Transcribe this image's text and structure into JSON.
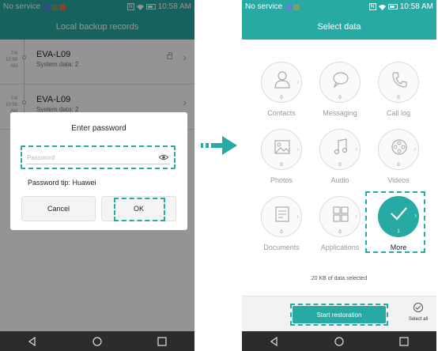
{
  "left": {
    "status": {
      "service": "No service",
      "time": "10:58 AM",
      "nfc": "N"
    },
    "title": "Local backup records",
    "records": [
      {
        "date_line1": "7/4",
        "date_line2": "10:58",
        "date_line3": "AM",
        "name": "EVA-L09",
        "sub": "System data: 2",
        "locked": true
      },
      {
        "date_line1": "7/4",
        "date_line2": "10:56",
        "date_line3": "AM",
        "name": "EVA-L09",
        "sub": "System data: 2",
        "locked": false
      }
    ],
    "dialog": {
      "title": "Enter password",
      "password_placeholder": "Password",
      "password_value": "",
      "tip": "Password tip: Huawei",
      "cancel_label": "Cancel",
      "ok_label": "OK"
    }
  },
  "right": {
    "status": {
      "service": "No service",
      "time": "10:58 AM",
      "nfc": "N"
    },
    "title": "Select data",
    "items": [
      {
        "label": "Contacts",
        "count": "0",
        "icon": "contacts-icon",
        "selected": false
      },
      {
        "label": "Messaging",
        "count": "0",
        "icon": "messaging-icon",
        "selected": false
      },
      {
        "label": "Call log",
        "count": "0",
        "icon": "call-log-icon",
        "selected": false
      },
      {
        "label": "Photos",
        "count": "0",
        "icon": "photos-icon",
        "selected": false
      },
      {
        "label": "Audio",
        "count": "0",
        "icon": "audio-icon",
        "selected": false
      },
      {
        "label": "Videos",
        "count": "0",
        "icon": "videos-icon",
        "selected": false
      },
      {
        "label": "Documents",
        "count": "0",
        "icon": "documents-icon",
        "selected": false
      },
      {
        "label": "Applications",
        "count": "0",
        "icon": "applications-icon",
        "selected": false
      },
      {
        "label": "More",
        "count": "1",
        "icon": "check-icon",
        "selected": true
      }
    ],
    "summary": "20 KB of data selected",
    "start_label": "Start restoration",
    "select_all_label": "Select all"
  },
  "colors": {
    "accent": "#27aaa3",
    "navbar": "#2c2c2c"
  }
}
